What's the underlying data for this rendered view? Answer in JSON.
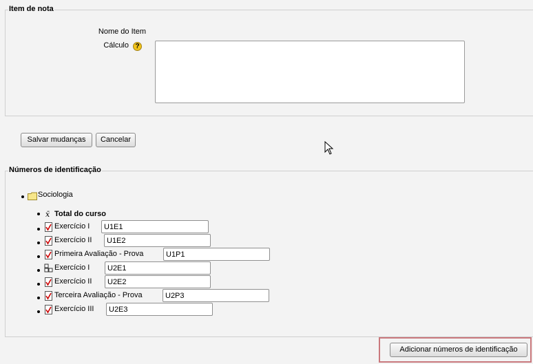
{
  "item_de_nota": {
    "legend": "Item de nota",
    "nome_label": "Nome do Item",
    "calculo_label": "Cálculo",
    "help_glyph": "?",
    "calculo_value": ""
  },
  "actions": {
    "save": "Salvar mudanças",
    "cancel": "Cancelar"
  },
  "ids_section": {
    "legend": "Números de identificação",
    "category": "Sociologia",
    "total": "Total do curso",
    "items": [
      {
        "name": "Exercício I",
        "id": "U1E1",
        "icon": "grade-item-icon"
      },
      {
        "name": "Exercício II",
        "id": "U1E2",
        "icon": "grade-item-icon"
      },
      {
        "name": "Primeira Avaliação - Prova",
        "id": "U1P1",
        "icon": "grade-item-icon"
      },
      {
        "name": "Exercício I",
        "id": "U2E1",
        "icon": "outcome-icon"
      },
      {
        "name": "Exercício II",
        "id": "U2E2",
        "icon": "grade-item-icon"
      },
      {
        "name": "Terceira Avaliação - Prova",
        "id": "U2P3",
        "icon": "grade-item-icon"
      },
      {
        "name": "Exercício III",
        "id": "U2E3",
        "icon": "grade-item-icon"
      }
    ],
    "add_button": "Adicionar números de identificação"
  },
  "colors": {
    "background": "#f3f3f3",
    "border": "#cfcfcf",
    "highlight": "#c9787c",
    "help": "#f2c318"
  }
}
